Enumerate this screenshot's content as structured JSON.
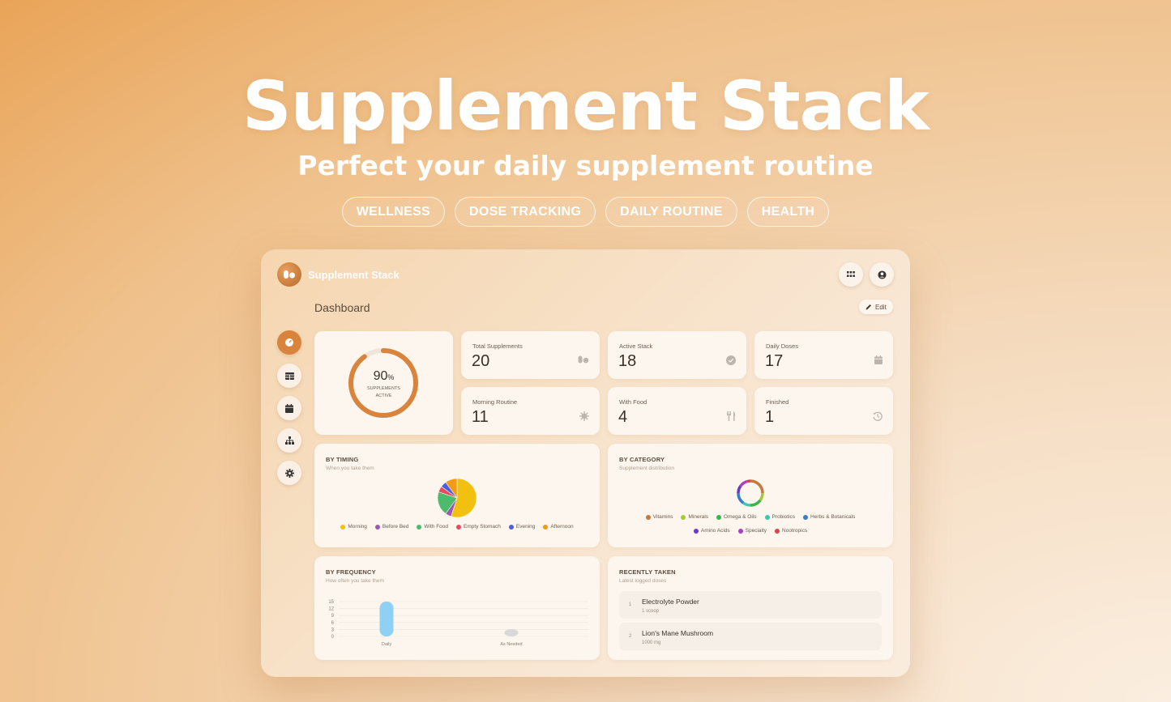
{
  "hero": {
    "title": "Supplement Stack",
    "subtitle": "Perfect your daily supplement routine",
    "tags": [
      "WELLNESS",
      "DOSE TRACKING",
      "DAILY ROUTINE",
      "HEALTH"
    ]
  },
  "app": {
    "name": "Supplement Stack",
    "page_title": "Dashboard",
    "edit_label": "Edit",
    "top_icons": [
      "apps-grid-icon",
      "user-circle-icon"
    ],
    "nav": [
      {
        "name": "dashboard",
        "icon": "gauge-icon",
        "active": true
      },
      {
        "name": "table",
        "icon": "table-icon",
        "active": false
      },
      {
        "name": "calendar",
        "icon": "calendar-icon",
        "active": false
      },
      {
        "name": "hierarchy",
        "icon": "sitemap-icon",
        "active": false
      },
      {
        "name": "settings",
        "icon": "gear-icon",
        "active": false
      }
    ]
  },
  "ring": {
    "percent_value": "90",
    "percent_unit": "%",
    "label_line1": "SUPPLEMENTS",
    "label_line2": "ACTIVE",
    "fraction": 0.9,
    "color": "#d9843c"
  },
  "stats": [
    {
      "label": "Total Supplements",
      "value": "20",
      "icon": "pills-icon"
    },
    {
      "label": "Active Stack",
      "value": "18",
      "icon": "check-circle-icon"
    },
    {
      "label": "Daily Doses",
      "value": "17",
      "icon": "calendar-icon"
    },
    {
      "label": "Morning Routine",
      "value": "11",
      "icon": "sun-icon"
    },
    {
      "label": "With Food",
      "value": "4",
      "icon": "utensils-icon"
    },
    {
      "label": "Finished",
      "value": "1",
      "icon": "history-icon"
    }
  ],
  "timing": {
    "title": "BY TIMING",
    "subtitle": "When you take them",
    "legend": [
      {
        "name": "Morning",
        "color": "#f2c10f"
      },
      {
        "name": "Before Bed",
        "color": "#9b59b6"
      },
      {
        "name": "With Food",
        "color": "#4cbb6c"
      },
      {
        "name": "Empty Stomach",
        "color": "#e84a5f"
      },
      {
        "name": "Evening",
        "color": "#4a5fd8"
      },
      {
        "name": "Afternoon",
        "color": "#f39c12"
      }
    ]
  },
  "category": {
    "title": "BY CATEGORY",
    "subtitle": "Supplement distribution",
    "legend_row1": [
      {
        "name": "Vitamins",
        "color": "#c9773a"
      },
      {
        "name": "Minerals",
        "color": "#a3c93a"
      },
      {
        "name": "Omega & Oils",
        "color": "#3ab54a"
      },
      {
        "name": "Probiotics",
        "color": "#3ac9b0"
      },
      {
        "name": "Herbs & Botanicals",
        "color": "#3a7ac9"
      }
    ],
    "legend_row2": [
      {
        "name": "Amino Acids",
        "color": "#6a3ac9"
      },
      {
        "name": "Specialty",
        "color": "#b03ac9"
      },
      {
        "name": "Nootropics",
        "color": "#d9434f"
      }
    ]
  },
  "frequency": {
    "title": "BY FREQUENCY",
    "subtitle": "How often you take them"
  },
  "recent": {
    "title": "RECENTLY TAKEN",
    "subtitle": "Latest logged doses",
    "items": [
      {
        "index": "1",
        "name": "Electrolyte Powder",
        "dose": "1 scoop"
      },
      {
        "index": "2",
        "name": "Lion's Mane Mushroom",
        "dose": "1000 mg"
      }
    ]
  },
  "chart_data": [
    {
      "type": "pie",
      "title": "BY TIMING",
      "categories": [
        "Morning",
        "Before Bed",
        "With Food",
        "Empty Stomach",
        "Evening",
        "Afternoon"
      ],
      "values": [
        11,
        1,
        4,
        1,
        1,
        2
      ],
      "colors": [
        "#f2c10f",
        "#9b59b6",
        "#4cbb6c",
        "#e84a5f",
        "#4a5fd8",
        "#f39c12"
      ]
    },
    {
      "type": "pie",
      "title": "BY CATEGORY",
      "categories": [
        "Vitamins",
        "Minerals",
        "Omega & Oils",
        "Probiotics",
        "Herbs & Botanicals",
        "Amino Acids",
        "Specialty",
        "Nootropics"
      ],
      "values": [
        5,
        2,
        3,
        2,
        3,
        2,
        2,
        1
      ],
      "colors": [
        "#c9773a",
        "#a3c93a",
        "#3ab54a",
        "#3ac9b0",
        "#3a7ac9",
        "#6a3ac9",
        "#b03ac9",
        "#d9434f"
      ]
    },
    {
      "type": "bar",
      "title": "BY FREQUENCY",
      "categories": [
        "Daily",
        "As Needed"
      ],
      "values": [
        17,
        1
      ],
      "yticks": [
        "15",
        "12",
        "9",
        "6",
        "3",
        "0"
      ],
      "ylim": [
        0,
        15
      ],
      "colors": [
        "#8fd0f5",
        "#d8d8d8"
      ]
    }
  ]
}
